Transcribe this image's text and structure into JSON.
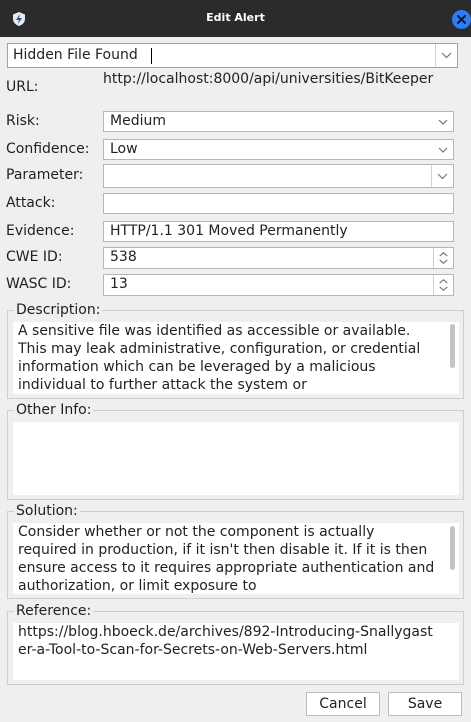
{
  "window": {
    "title": "Edit Alert"
  },
  "alert_name": {
    "value": "Hidden File Found"
  },
  "labels": {
    "url": "URL:",
    "risk": "Risk:",
    "confidence": "Confidence:",
    "parameter": "Parameter:",
    "attack": "Attack:",
    "evidence": "Evidence:",
    "cwe_id": "CWE ID:",
    "wasc_id": "WASC ID:"
  },
  "fields": {
    "url": "http://localhost:8000/api/universities/BitKeeper",
    "risk": "Medium",
    "confidence": "Low",
    "parameter": "",
    "attack": "",
    "evidence": "HTTP/1.1 301 Moved Permanently",
    "cwe_id": "538",
    "wasc_id": "13"
  },
  "sections": {
    "description": {
      "legend": "Description:",
      "text": "A sensitive file was identified as accessible or available. This may leak administrative, configuration, or credential information which can be leveraged by a malicious individual to further attack the system or"
    },
    "other_info": {
      "legend": "Other Info:",
      "text": ""
    },
    "solution": {
      "legend": "Solution:",
      "text": "Consider whether or not the component is actually required in production, if it isn't then disable it. If it is then ensure access to it requires appropriate authentication and authorization, or limit exposure to"
    },
    "reference": {
      "legend": "Reference:",
      "text": "https://blog.hboeck.de/archives/892-Introducing-Snallygaster-a-Tool-to-Scan-for-Secrets-on-Web-Servers.html"
    }
  },
  "buttons": {
    "cancel": "Cancel",
    "save": "Save"
  },
  "colors": {
    "titlebar": "#2b2b2b",
    "close": "#2f7cf6",
    "focus": "#7fa7e6"
  },
  "icons": {
    "app": "zap-shield-icon",
    "close": "close-icon",
    "dropdown": "chevron-down-icon",
    "spinner": "spinner-arrows-icon"
  }
}
